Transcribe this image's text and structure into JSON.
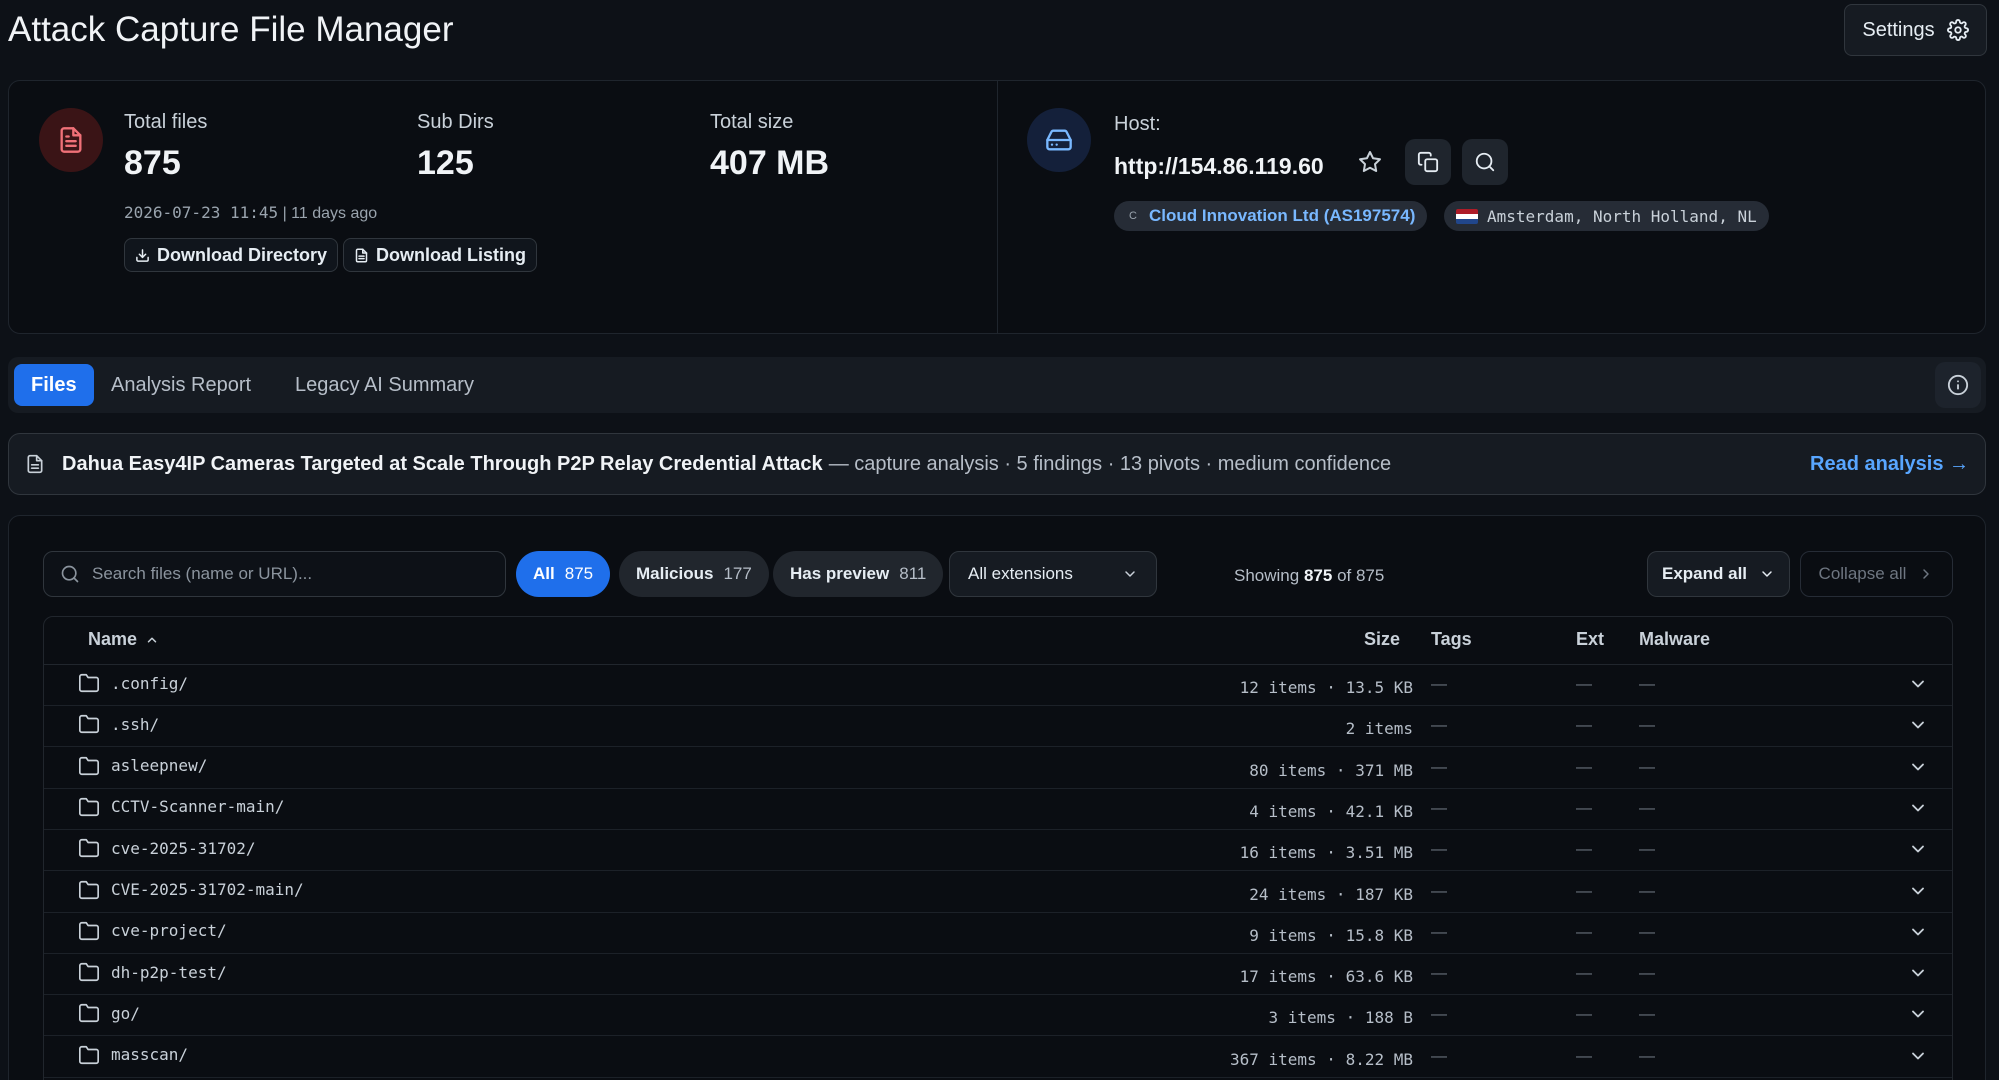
{
  "header": {
    "title": "Attack Capture File Manager",
    "settings_label": "Settings"
  },
  "summary": {
    "total_files_label": "Total files",
    "total_files": "875",
    "subdirs_label": "Sub Dirs",
    "subdirs": "125",
    "total_size_label": "Total size",
    "total_size": "407 MB",
    "date": "2026-07-23 11:45",
    "ago": "| 11 days ago",
    "download_directory": "Download Directory",
    "download_listing": "Download Listing"
  },
  "host": {
    "label": "Host:",
    "url": "http://154.86.119.60",
    "asn_letter": "C",
    "asn": "Cloud Innovation Ltd (AS197574)",
    "location": "Amsterdam, North Holland, NL"
  },
  "tabs": [
    {
      "label": "Files",
      "active": true
    },
    {
      "label": "Analysis Report",
      "active": false
    },
    {
      "label": "Legacy AI Summary",
      "active": false
    }
  ],
  "analysis": {
    "title": "Dahua Easy4IP Cameras Targeted at Scale Through P2P Relay Credential Attack",
    "meta": "— capture analysis · 5 findings · 13 pivots · medium confidence",
    "read_link": "Read analysis →"
  },
  "filters": {
    "search_placeholder": "Search files (name or URL)...",
    "chips": [
      {
        "label": "All",
        "count": "875"
      },
      {
        "label": "Malicious",
        "count": "177"
      },
      {
        "label": "Has preview",
        "count": "811"
      }
    ],
    "extensions": "All extensions",
    "showing_prefix": "Showing",
    "showing_count": "875",
    "showing_suffix": "of 875",
    "expand_all": "Expand all",
    "collapse_all": "Collapse all"
  },
  "table": {
    "columns": {
      "name": "Name",
      "size": "Size",
      "tags": "Tags",
      "ext": "Ext",
      "malware": "Malware"
    },
    "empty": "—",
    "rows": [
      {
        "name": ".config/",
        "size": "12 items · 13.5 KB"
      },
      {
        "name": ".ssh/",
        "size": "2 items"
      },
      {
        "name": "asleepnew/",
        "size": "80 items · 371 MB"
      },
      {
        "name": "CCTV-Scanner-main/",
        "size": "4 items · 42.1 KB"
      },
      {
        "name": "cve-2025-31702/",
        "size": "16 items · 3.51 MB"
      },
      {
        "name": "CVE-2025-31702-main/",
        "size": "24 items · 187 KB"
      },
      {
        "name": "cve-project/",
        "size": "9 items · 15.8 KB"
      },
      {
        "name": "dh-p2p-test/",
        "size": "17 items · 63.6 KB"
      },
      {
        "name": "go/",
        "size": "3 items · 188 B"
      },
      {
        "name": "masscan/",
        "size": "367 items · 8.22 MB"
      }
    ]
  },
  "colors": {
    "background": "#0d1117",
    "accent": "#1f6feb",
    "link": "#58a6ff",
    "danger_icon": "#f07178"
  }
}
